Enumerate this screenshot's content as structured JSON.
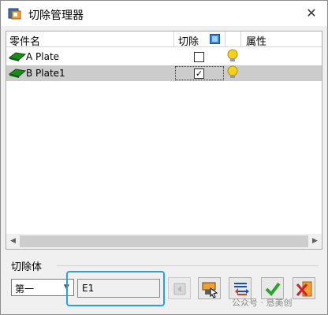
{
  "window": {
    "title": "切除管理器",
    "close_symbol": "✕"
  },
  "table": {
    "columns": {
      "part_name": "零件名",
      "cut": "切除",
      "attributes": "属性"
    },
    "rows": [
      {
        "name": "A Plate",
        "cut_checked": false,
        "cut_mark": "",
        "selected": false
      },
      {
        "name": "B Plate1",
        "cut_checked": true,
        "cut_mark": "✓",
        "selected": true
      }
    ]
  },
  "scrollbar": {
    "left_arrow": "◀",
    "right_arrow": "▶"
  },
  "cut_body": {
    "group_label": "切除体",
    "order_select": {
      "value": "第一",
      "arrow": "▼"
    },
    "body_field": {
      "value": "E1"
    }
  },
  "watermark": "公众号 · 恳美创",
  "colors": {
    "highlight_border": "#29a0e6",
    "selected_row": "#cccccc",
    "bulb": "#f7d117",
    "part_icon": "#1a8a1a",
    "ok_check": "#2aa52a"
  }
}
